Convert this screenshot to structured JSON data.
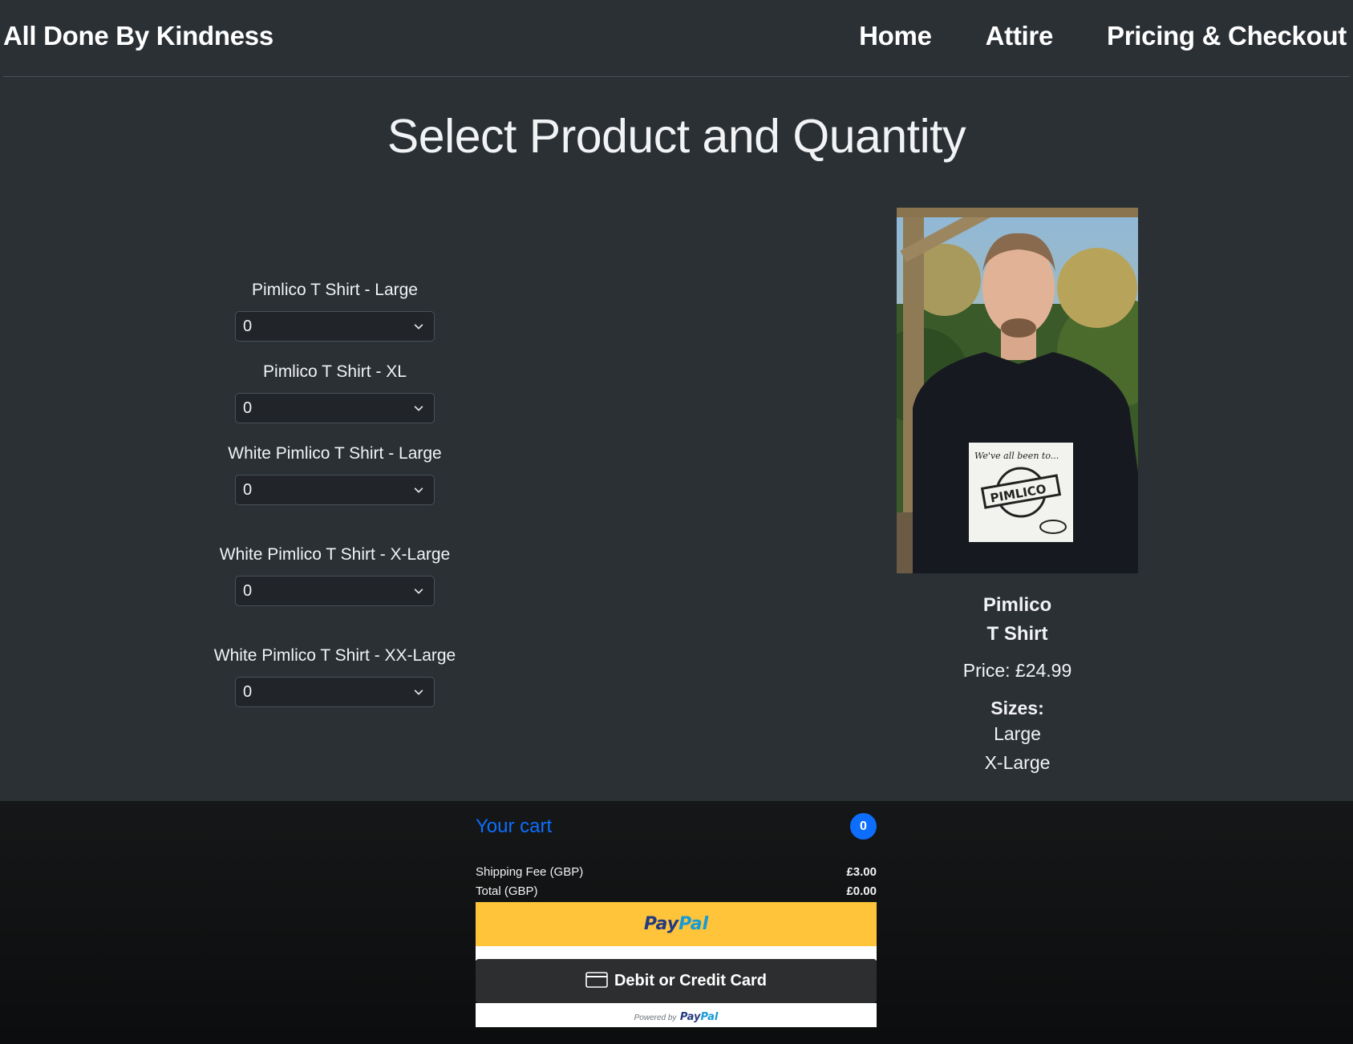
{
  "header": {
    "brand": "All Done By Kindness",
    "nav": [
      {
        "label": "Home"
      },
      {
        "label": "Attire"
      },
      {
        "label": "Pricing & Checkout"
      }
    ]
  },
  "main": {
    "title": "Select Product and Quantity",
    "selectors": [
      {
        "label": "Pimlico T Shirt - Large",
        "value": "0"
      },
      {
        "label": "Pimlico T Shirt - XL",
        "value": "0"
      },
      {
        "label": "White Pimlico T Shirt - Large",
        "value": "0"
      },
      {
        "label": "White Pimlico T Shirt - X-Large",
        "value": "0"
      },
      {
        "label": "White Pimlico T Shirt - XX-Large",
        "value": "0"
      }
    ],
    "product": {
      "name_line1": "Pimlico",
      "name_line2": "T Shirt",
      "price": "Price: £24.99",
      "sizes_heading": "Sizes:",
      "sizes": [
        "Large",
        "X-Large"
      ],
      "shirt_print_text": "We've all been to...",
      "shirt_print_logo": "PIMLICO"
    }
  },
  "cart": {
    "title": "Your cart",
    "count": "0",
    "shipping_label": "Shipping Fee (GBP)",
    "shipping_value": "£3.00",
    "total_label": "Total (GBP)",
    "total_value": "£0.00",
    "paypal_part1": "Pay",
    "paypal_part2": "Pal",
    "card_button": "Debit or Credit Card",
    "powered_by": "Powered by",
    "powered_logo_part1": "Pay",
    "powered_logo_part2": "Pal"
  },
  "colors": {
    "page_bg": "#2b3035",
    "footer_bg": "#0e0f10",
    "accent_blue": "#0d6efd",
    "paypal_yellow": "#ffc439",
    "card_button_bg": "#2c2e2f"
  }
}
